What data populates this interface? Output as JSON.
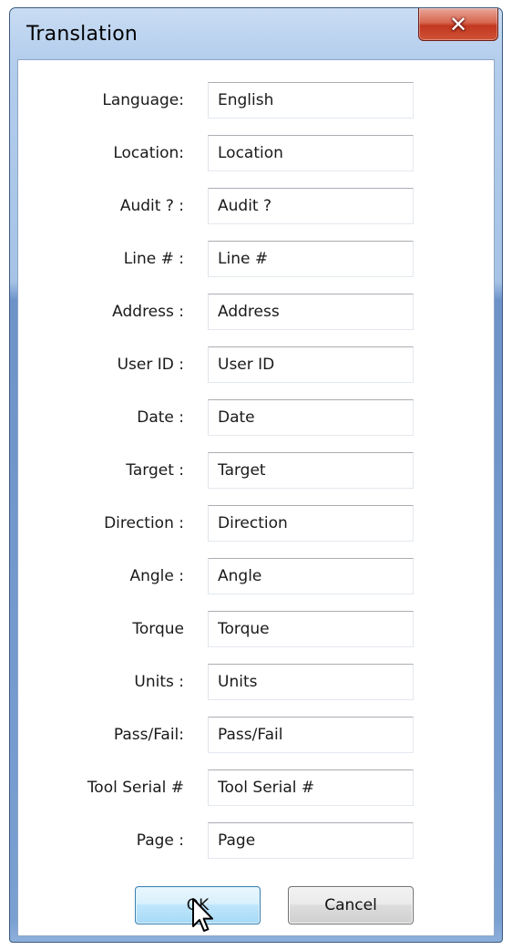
{
  "window": {
    "title": "Translation",
    "close_icon": "close-x-icon"
  },
  "fields": [
    {
      "label": "Language:",
      "value": "English"
    },
    {
      "label": "Location:",
      "value": "Location"
    },
    {
      "label": "Audit ? :",
      "value": "Audit ?"
    },
    {
      "label": "Line # :",
      "value": "Line #"
    },
    {
      "label": "Address :",
      "value": "Address"
    },
    {
      "label": "User ID :",
      "value": "User ID"
    },
    {
      "label": "Date :",
      "value": "Date"
    },
    {
      "label": "Target :",
      "value": "Target"
    },
    {
      "label": "Direction :",
      "value": "Direction"
    },
    {
      "label": "Angle :",
      "value": "Angle"
    },
    {
      "label": "Torque",
      "value": "Torque"
    },
    {
      "label": "Units :",
      "value": "Units"
    },
    {
      "label": "Pass/Fail:",
      "value": "Pass/Fail"
    },
    {
      "label": "Tool Serial #",
      "value": "Tool Serial #"
    },
    {
      "label": "Page :",
      "value": "Page"
    }
  ],
  "buttons": {
    "ok_label": "OK",
    "cancel_label": "Cancel"
  },
  "colors": {
    "title_bar": "#b3cdec",
    "close_button": "#c2381f",
    "ok_button_focus": "#3c7fb1"
  },
  "cursor": "arrow-pointer-icon"
}
